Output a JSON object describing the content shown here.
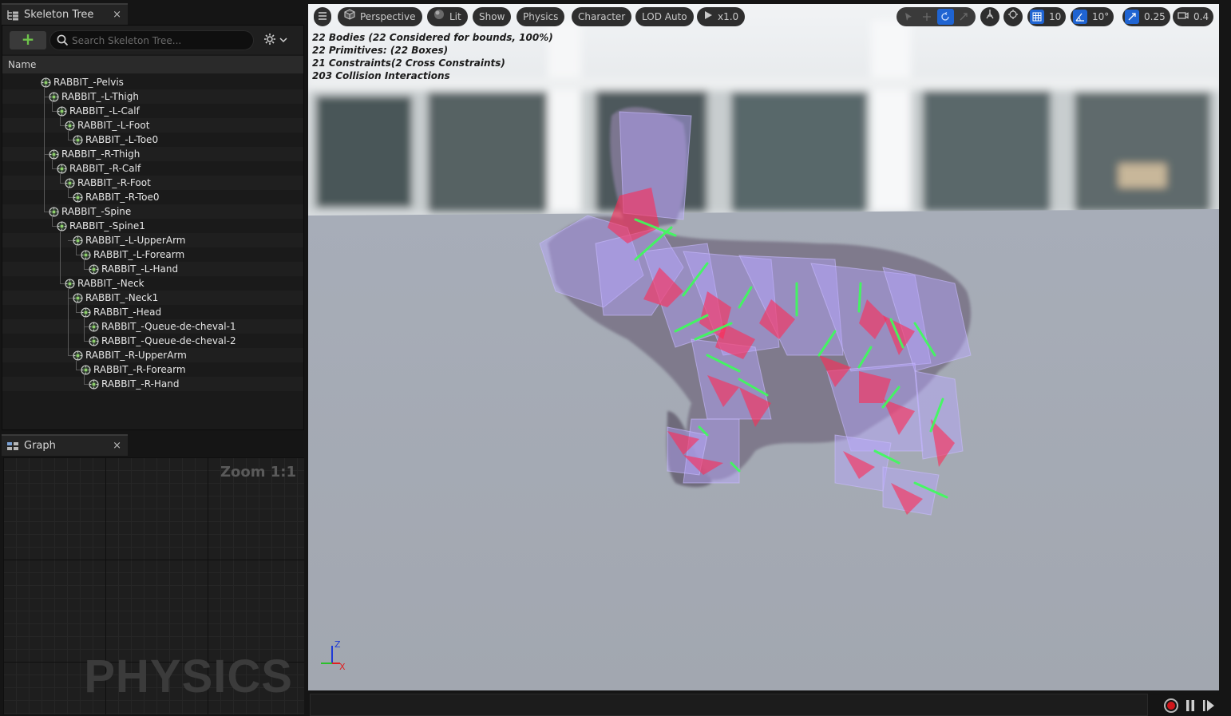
{
  "skeleton_tree": {
    "tab_title": "Skeleton Tree",
    "tab_close": "×",
    "add_label": "+",
    "search_placeholder": "Search Skeleton Tree...",
    "column_header": "Name",
    "bones": [
      {
        "name": "RABBIT_-Pelvis",
        "depth": 0
      },
      {
        "name": "RABBIT_-L-Thigh",
        "depth": 1
      },
      {
        "name": "RABBIT_-L-Calf",
        "depth": 2
      },
      {
        "name": "RABBIT_-L-Foot",
        "depth": 3
      },
      {
        "name": "RABBIT_-L-Toe0",
        "depth": 4
      },
      {
        "name": "RABBIT_-R-Thigh",
        "depth": 1
      },
      {
        "name": "RABBIT_-R-Calf",
        "depth": 2
      },
      {
        "name": "RABBIT_-R-Foot",
        "depth": 3
      },
      {
        "name": "RABBIT_-R-Toe0",
        "depth": 4
      },
      {
        "name": "RABBIT_-Spine",
        "depth": 1
      },
      {
        "name": "RABBIT_-Spine1",
        "depth": 2
      },
      {
        "name": "RABBIT_-L-UpperArm",
        "depth": 4
      },
      {
        "name": "RABBIT_-L-Forearm",
        "depth": 5
      },
      {
        "name": "RABBIT_-L-Hand",
        "depth": 6
      },
      {
        "name": "RABBIT_-Neck",
        "depth": 3
      },
      {
        "name": "RABBIT_-Neck1",
        "depth": 4
      },
      {
        "name": "RABBIT_-Head",
        "depth": 5
      },
      {
        "name": "RABBIT_-Queue-de-cheval-1",
        "depth": 6
      },
      {
        "name": "RABBIT_-Queue-de-cheval-2",
        "depth": 6
      },
      {
        "name": "RABBIT_-R-UpperArm",
        "depth": 4
      },
      {
        "name": "RABBIT_-R-Forearm",
        "depth": 5
      },
      {
        "name": "RABBIT_-R-Hand",
        "depth": 6
      }
    ]
  },
  "graph": {
    "tab_title": "Graph",
    "tab_close": "×",
    "zoom_label": "Zoom 1:1",
    "watermark": "PHYSICS"
  },
  "viewport": {
    "toolbar": {
      "menu_icon": "hamburger-icon",
      "perspective": "Perspective",
      "lit": "Lit",
      "show": "Show",
      "physics": "Physics",
      "character": "Character",
      "lod": "LOD Auto",
      "play_speed": "x1.0",
      "grid_snap": "10",
      "rotation_snap": "10°",
      "scale_snap": "0.25",
      "camera_speed": "0.4"
    },
    "stats": [
      "22 Bodies (22 Considered for bounds, 100%)",
      "22 Primitives: (22 Boxes)",
      "21 Constraints(2 Cross Constraints)",
      "203 Collision Interactions"
    ],
    "axis": {
      "z": "Z",
      "x": "X"
    }
  },
  "colors": {
    "accent_blue": "#1f64d2",
    "record_red": "#d0161b",
    "body_purple": "#9f8fd8",
    "constraint_red": "#ff2a55",
    "constraint_green": "#3cff5a"
  }
}
